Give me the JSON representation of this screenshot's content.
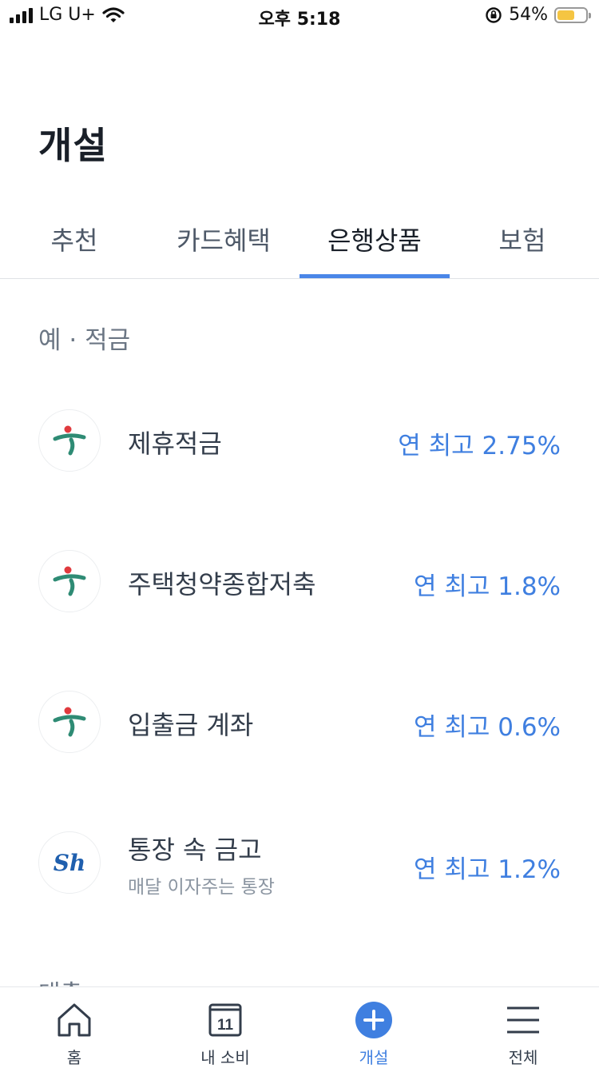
{
  "status_bar": {
    "carrier": "LG U+",
    "time": "오후 5:18",
    "battery": "54%",
    "battery_level": 0.54,
    "battery_color": "#f5c542"
  },
  "page": {
    "title": "개설"
  },
  "tabs": [
    {
      "label": "추천",
      "active": false
    },
    {
      "label": "카드혜택",
      "active": false
    },
    {
      "label": "은행상품",
      "active": true
    },
    {
      "label": "보험",
      "active": false
    }
  ],
  "section": {
    "label": "예 · 적금"
  },
  "products": [
    {
      "name": "제휴적금",
      "subtitle": "",
      "rate": "연 최고 2.75%",
      "logo": "hana-bank-logo"
    },
    {
      "name": "주택청약종합저축",
      "subtitle": "",
      "rate": "연 최고 1.8%",
      "logo": "hana-bank-logo"
    },
    {
      "name": "입출금 계좌",
      "subtitle": "",
      "rate": "연 최고 0.6%",
      "logo": "hana-bank-logo"
    },
    {
      "name": "통장 속 금고",
      "subtitle": "매달 이자주는 통장",
      "rate": "연 최고 1.2%",
      "logo": "sh-bank-logo"
    }
  ],
  "next_section_partial": "대출",
  "bottom_nav": [
    {
      "label": "홈",
      "icon": "home-icon",
      "active": false
    },
    {
      "label": "내 소비",
      "icon": "calendar-icon",
      "badge": "11",
      "active": false
    },
    {
      "label": "개설",
      "icon": "plus-circle-icon",
      "active": true
    },
    {
      "label": "전체",
      "icon": "menu-icon",
      "active": false
    }
  ],
  "colors": {
    "accent": "#3f7fe0",
    "tab_indicator": "#4a86e8",
    "hana_green": "#2e8b74",
    "hana_red": "#e03a3e",
    "sh_blue": "#1f5fae"
  }
}
